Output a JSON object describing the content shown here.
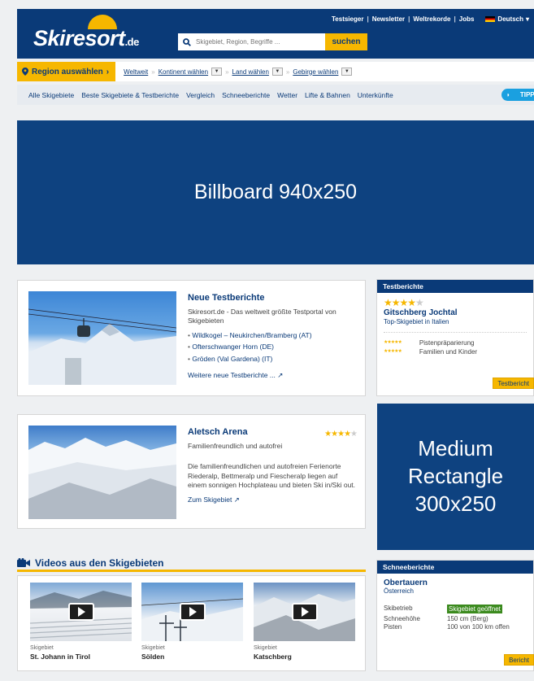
{
  "header": {
    "toplinks": [
      "Testsieger",
      "Newsletter",
      "Weltrekorde",
      "Jobs"
    ],
    "language": "Deutsch",
    "logo_text": "Skiresort",
    "logo_tld": ".de",
    "search_placeholder": "Skigebiet, Region, Begriffe ...",
    "search_button": "suchen"
  },
  "regionbar": {
    "button": "Region auswählen",
    "worldwide": "Weltweit",
    "continent": "Kontinent wählen",
    "country": "Land wählen",
    "mountains": "Gebirge wählen"
  },
  "nav": {
    "items": [
      "Alle Skigebiete",
      "Beste Skigebiete & Testberichte",
      "Vergleich",
      "Schneeberichte",
      "Wetter",
      "Lifte & Bahnen",
      "Unterkünfte"
    ],
    "tipp": "TIPPS"
  },
  "billboard": "Billboard 940x250",
  "card1": {
    "title": "Neue Testberichte",
    "intro": "Skiresort.de - Das weltweit größte Testportal von Skigebieten",
    "items": [
      "Wildkogel – Neukirchen/Bramberg (AT)",
      "Ofterschwanger Horn (DE)",
      "Gröden (Val Gardena) (IT)"
    ],
    "more": "Weitere neue Testberichte ..."
  },
  "card2": {
    "title": "Aletsch Arena",
    "subtitle": "Familienfreundlich und autofrei",
    "text": "Die familienfreundlichen und autofreien Ferienorte Riederalp, Bettmeralp und Fiescheralp liegen auf einem sonnigen Hochplateau und bieten Ski in/Ski out.",
    "link": "Zum Skigebiet",
    "rating": 4.5
  },
  "testberichte": {
    "header": "Testberichte",
    "resort": "Gitschberg Jochtal",
    "tagline": "Top-Skigebiet in Italien",
    "rating": 4,
    "criteria": [
      "Pistenpräparierung",
      "Familien und Kinder"
    ],
    "button": "Testbericht"
  },
  "medium_rect": [
    "Medium",
    "Rectangle",
    "300x250"
  ],
  "schneeberichte": {
    "header": "Schneeberichte",
    "resort": "Obertauern",
    "country": "Österreich",
    "rows": [
      {
        "label": "Skibetrieb",
        "value": "Skigebiet geöffnet"
      },
      {
        "label": "Schneehöhe",
        "value": "150 cm (Berg)"
      },
      {
        "label": "Pisten",
        "value": "100 von 100 km offen"
      }
    ],
    "button": "Bericht"
  },
  "videos": {
    "header": "Videos aus den Skigebieten",
    "items": [
      {
        "label": "Skigebiet",
        "name": "St. Johann in Tirol"
      },
      {
        "label": "Skigebiet",
        "name": "Sölden"
      },
      {
        "label": "Skigebiet",
        "name": "Katschberg"
      }
    ]
  }
}
